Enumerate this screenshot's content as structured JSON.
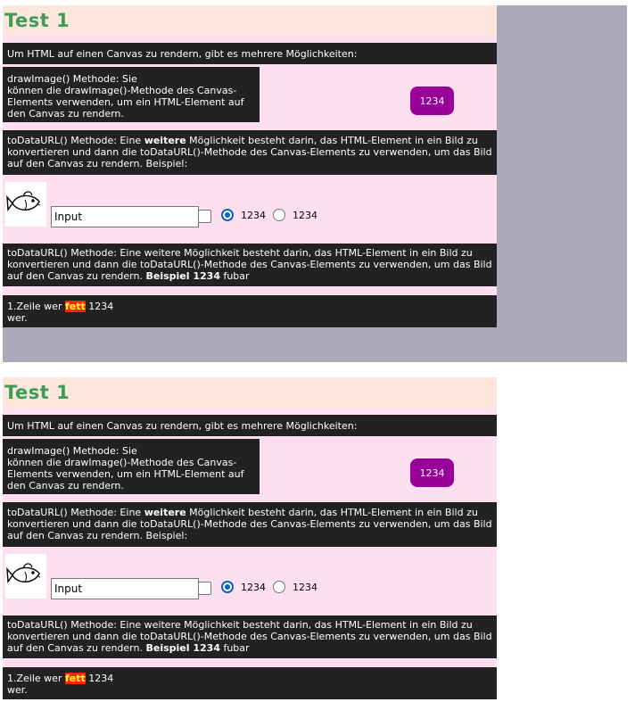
{
  "title": "Test 1",
  "intro": "Um HTML auf einen Canvas zu rendern, gibt es mehrere Möglichkeiten:",
  "draw_image": {
    "line1": "drawImage() Methode: Sie",
    "line2": "können die drawImage()-Methode des Canvas-",
    "line3": "Elements verwenden, um ein HTML-Element auf",
    "line4": "den Canvas zu rendern."
  },
  "pill_label": "1234",
  "todataurl_1": {
    "before": "toDataURL() Methode: Eine ",
    "bold": "weitere",
    "after": " Möglichkeit besteht darin, das HTML-Element in ein Bild zu konvertieren und dann die toDataURL()-Methode des Canvas-Elements zu verwenden, um das Bild auf den Canvas zu rendern. Beispiel:"
  },
  "form": {
    "input_value": "Input",
    "checkbox_checked": false,
    "radio1_label": "1234",
    "radio1_checked": true,
    "radio2_label": "1234",
    "radio2_checked": false
  },
  "todataurl_2": {
    "text": "toDataURL() Methode: Eine weitere Möglichkeit besteht darin, das HTML-Element in ein Bild zu konvertieren und dann die toDataURL()-Methode des Canvas-Elements zu verwenden, um das Bild auf den Canvas zu rendern. ",
    "bold": "Beispiel 1234",
    "after": " fubar"
  },
  "zeile": {
    "before": "1.Zeile wer ",
    "highlight": "fett",
    "after": " 1234",
    "line2": "wer."
  },
  "colors": {
    "title": "#3f9c54",
    "pill": "#990099",
    "highlight_bg": "#ff2200",
    "highlight_fg": "#ffff33"
  }
}
